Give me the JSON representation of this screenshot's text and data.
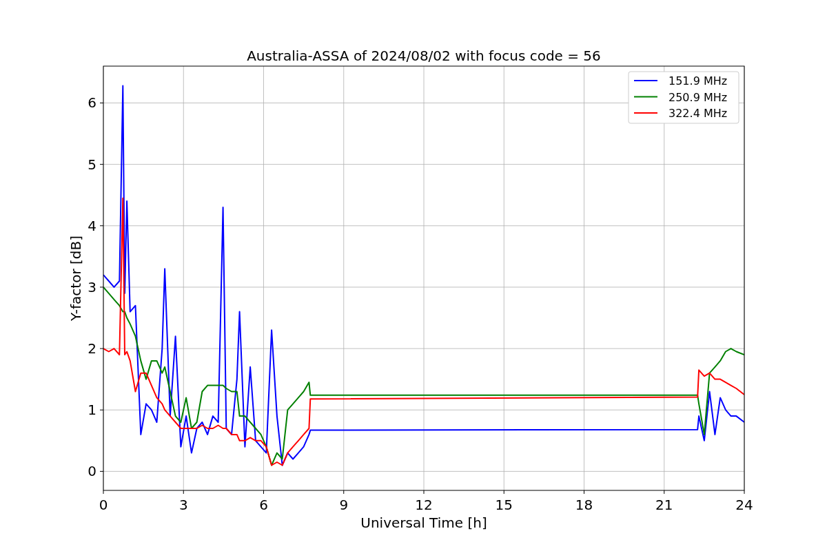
{
  "chart_data": {
    "type": "line",
    "title": "Australia-ASSA of 2024/08/02 with focus code = 56",
    "xlabel": "Universal Time [h]",
    "ylabel": "Y-factor [dB]",
    "x": [
      0,
      0.2,
      0.4,
      0.6,
      0.73,
      0.8,
      0.88,
      1.0,
      1.2,
      1.4,
      1.6,
      1.8,
      2.0,
      2.2,
      2.3,
      2.5,
      2.7,
      2.9,
      3.1,
      3.3,
      3.5,
      3.7,
      3.9,
      4.1,
      4.3,
      4.48,
      4.6,
      4.8,
      5.0,
      5.1,
      5.3,
      5.5,
      5.7,
      5.9,
      6.1,
      6.3,
      6.5,
      6.7,
      6.9,
      7.1,
      7.3,
      7.5,
      7.7,
      7.75,
      22.25,
      22.3,
      22.5,
      22.7,
      22.9,
      23.1,
      23.3,
      23.5,
      23.7,
      24
    ],
    "series": [
      {
        "name": "151.9 MHz",
        "color": "#0000ff",
        "values": [
          3.2,
          3.1,
          3.0,
          3.1,
          6.28,
          2.9,
          4.4,
          2.6,
          2.7,
          0.6,
          1.1,
          1.0,
          0.8,
          2.0,
          3.3,
          0.9,
          2.2,
          0.4,
          0.9,
          0.3,
          0.7,
          0.8,
          0.6,
          0.9,
          0.8,
          4.3,
          0.7,
          0.6,
          1.5,
          2.6,
          0.4,
          1.7,
          0.5,
          0.4,
          0.3,
          2.3,
          0.9,
          0.1,
          0.3,
          0.2,
          0.3,
          0.4,
          0.6,
          0.67,
          0.68,
          0.9,
          0.5,
          1.3,
          0.6,
          1.2,
          1.0,
          0.9,
          0.9,
          0.8
        ]
      },
      {
        "name": "250.9 MHz",
        "color": "#008000",
        "values": [
          3.0,
          2.9,
          2.8,
          2.7,
          2.6,
          2.6,
          2.5,
          2.4,
          2.2,
          1.8,
          1.5,
          1.8,
          1.8,
          1.6,
          1.7,
          1.3,
          0.9,
          0.8,
          1.2,
          0.7,
          0.8,
          1.3,
          1.4,
          1.4,
          1.4,
          1.4,
          1.35,
          1.3,
          1.3,
          0.9,
          0.9,
          0.8,
          0.7,
          0.6,
          0.4,
          0.1,
          0.3,
          0.2,
          1.0,
          1.1,
          1.2,
          1.3,
          1.45,
          1.24,
          1.24,
          1.1,
          0.6,
          1.6,
          1.7,
          1.8,
          1.95,
          2.0,
          1.95,
          1.9
        ]
      },
      {
        "name": "322.4 MHz",
        "color": "#ff0000",
        "values": [
          2.0,
          1.95,
          2.0,
          1.9,
          4.45,
          1.9,
          1.95,
          1.8,
          1.3,
          1.6,
          1.6,
          1.4,
          1.2,
          1.1,
          1.0,
          0.9,
          0.8,
          0.7,
          0.7,
          0.7,
          0.7,
          0.75,
          0.7,
          0.7,
          0.75,
          0.7,
          0.7,
          0.6,
          0.6,
          0.5,
          0.5,
          0.55,
          0.5,
          0.5,
          0.4,
          0.1,
          0.15,
          0.1,
          0.3,
          0.4,
          0.5,
          0.6,
          0.7,
          1.18,
          1.21,
          1.65,
          1.55,
          1.6,
          1.5,
          1.5,
          1.45,
          1.4,
          1.35,
          1.25
        ]
      }
    ],
    "xlim": [
      0,
      24
    ],
    "ylim": [
      -0.31,
      6.6
    ],
    "xticks": [
      0,
      3,
      6,
      9,
      12,
      15,
      18,
      21,
      24
    ],
    "yticks": [
      0,
      1,
      2,
      3,
      4,
      5,
      6
    ],
    "grid": true,
    "legend": true
  }
}
